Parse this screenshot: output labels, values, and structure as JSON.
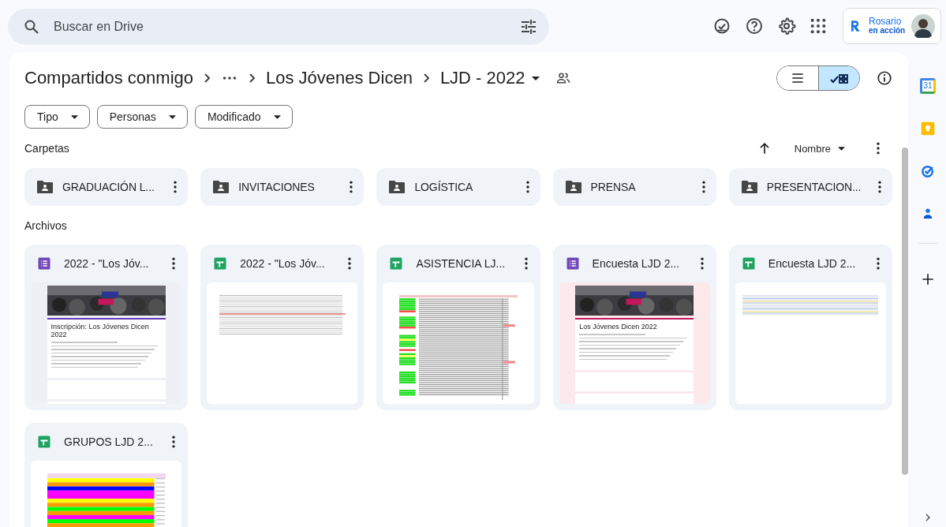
{
  "search": {
    "placeholder": "Buscar en Drive"
  },
  "account": {
    "brand_line_1": "Rosario",
    "brand_line_2": "en acción"
  },
  "breadcrumb": [
    {
      "kind": "crumb",
      "label": "Compartidos conmigo"
    },
    {
      "kind": "overflow"
    },
    {
      "kind": "crumb",
      "label": "Los Jóvenes Dicen"
    },
    {
      "kind": "current",
      "label": "LJD - 2022"
    }
  ],
  "view_modes": [
    {
      "kind": "list",
      "selected": false
    },
    {
      "kind": "grid",
      "selected": true
    }
  ],
  "filters": [
    "Tipo",
    "Personas",
    "Modificado"
  ],
  "folders_title": "Carpetas",
  "sort": {
    "label": "Nombre"
  },
  "folders": [
    {
      "name": "GRADUACIÓN L..."
    },
    {
      "name": "INVITACIONES"
    },
    {
      "name": "LOGÍSTICA"
    },
    {
      "name": "PRENSA"
    },
    {
      "name": "PRESENTACION..."
    }
  ],
  "files_title": "Archivos",
  "files": [
    {
      "name": "2022 - \"Los Jóv...",
      "kind": "form",
      "preview": {
        "kind": "form",
        "title": "Inscripción: Los Jóvenes Dicen 2022",
        "tint": false
      }
    },
    {
      "name": "2022 - \"Los Jóv...",
      "kind": "sheet",
      "preview": {
        "kind": "sheet-plain"
      }
    },
    {
      "name": "ASISTENCIA LJ...",
      "kind": "sheet",
      "preview": {
        "kind": "sheet-marked"
      }
    },
    {
      "name": "Encuesta LJD 2...",
      "kind": "form",
      "preview": {
        "kind": "form",
        "title": "Los Jóvenes Dicen 2022",
        "tint": true
      }
    },
    {
      "name": "Encuesta LJD 2...",
      "kind": "sheet",
      "preview": {
        "kind": "sheet-striped"
      }
    },
    {
      "name": "GRUPOS LJD 2...",
      "kind": "sheet",
      "preview": {
        "kind": "sheet-colored"
      }
    }
  ],
  "rail": [
    {
      "kind": "calendar",
      "label": "31"
    },
    {
      "kind": "keep"
    },
    {
      "kind": "tasks"
    },
    {
      "kind": "contacts"
    },
    {
      "kind": "divider"
    },
    {
      "kind": "add"
    }
  ]
}
